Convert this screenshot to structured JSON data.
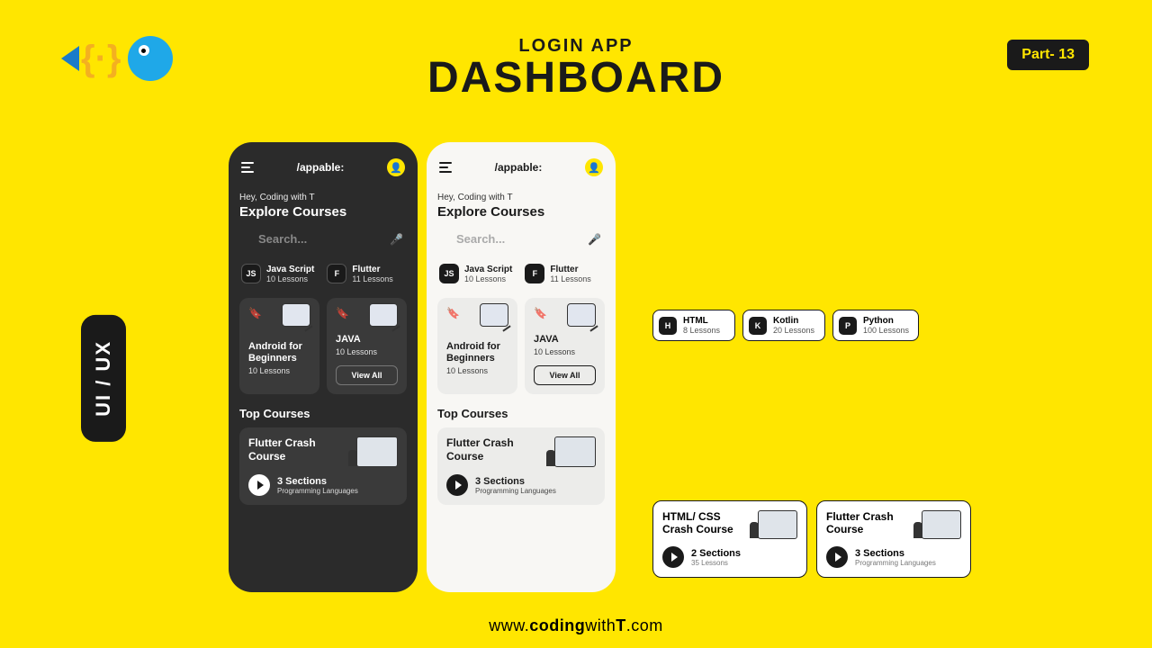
{
  "header": {
    "subtitle": "LOGIN APP",
    "title": "DASHBOARD"
  },
  "part_badge": "Part- 13",
  "uiux": "UI / UX",
  "phone": {
    "brand": "/appable:",
    "greeting": "Hey, Coding with T",
    "heading": "Explore Courses",
    "search_placeholder": "Search...",
    "chips": [
      {
        "badge": "JS",
        "title": "Java Script",
        "sub": "10 Lessons"
      },
      {
        "badge": "F",
        "title": "Flutter",
        "sub": "11 Lessons"
      }
    ],
    "cards": [
      {
        "title": "Android for Beginners",
        "sub": "10 Lessons"
      },
      {
        "title": "JAVA",
        "sub": "10 Lessons",
        "view_all": "View All"
      }
    ],
    "top_heading": "Top Courses",
    "course": {
      "title": "Flutter Crash Course",
      "sections": "3 Sections",
      "sub": "Programming Languages"
    }
  },
  "extra_chips": [
    {
      "badge": "H",
      "title": "HTML",
      "sub": "8 Lessons"
    },
    {
      "badge": "K",
      "title": "Kotlin",
      "sub": "20 Lessons"
    },
    {
      "badge": "P",
      "title": "Python",
      "sub": "100 Lessons"
    }
  ],
  "extra_courses": [
    {
      "title": "HTML/ CSS Crash Course",
      "sections": "2 Sections",
      "sub": "35 Lessons"
    },
    {
      "title": "Flutter Crash Course",
      "sections": "3 Sections",
      "sub": "Programming Languages"
    }
  ],
  "footer": {
    "p1": "www.",
    "p2": "coding",
    "p3": "with",
    "p4": "T",
    "p5": ".com"
  }
}
